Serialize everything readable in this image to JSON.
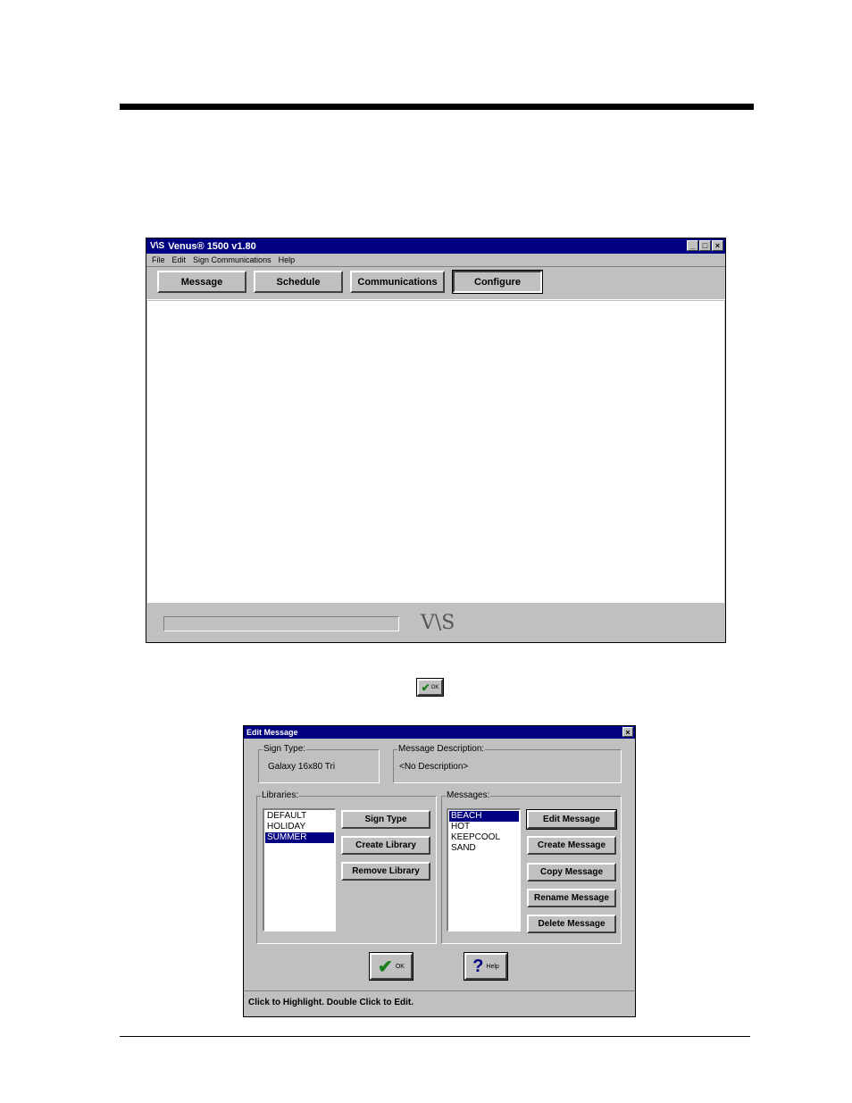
{
  "main_window": {
    "title": "Venus® 1500 v1.80",
    "app_icon": "V\\S",
    "title_buttons": [
      "_",
      "□",
      "×"
    ],
    "menu": [
      "File",
      "Edit",
      "Sign Communications",
      "Help"
    ],
    "toolbar": [
      "Message",
      "Schedule",
      "Communications",
      "Configure"
    ],
    "status_logo": "V\\S"
  },
  "inline_icon": {
    "label": "OK"
  },
  "edit_dialog": {
    "title": "Edit Message",
    "sign_type": {
      "label": "Sign Type:",
      "value": "Galaxy 16x80 Tri"
    },
    "message_description": {
      "label": "Message Description:",
      "value": "<No Description>"
    },
    "libraries": {
      "label": "Libraries:",
      "items": [
        "DEFAULT",
        "HOLIDAY",
        "SUMMER"
      ],
      "selected": 2
    },
    "library_buttons": [
      "Sign Type",
      "Create Library",
      "Remove Library"
    ],
    "messages": {
      "label": "Messages:",
      "items": [
        "BEACH",
        "HOT",
        "KEEPCOOL",
        "SAND"
      ],
      "selected": 0
    },
    "message_buttons": [
      "Edit Message",
      "Create Message",
      "Copy Message",
      "Rename Message",
      "Delete Message"
    ],
    "ok_label": "OK",
    "help_label": "Help",
    "status": "Click to Highlight.  Double Click to Edit."
  }
}
